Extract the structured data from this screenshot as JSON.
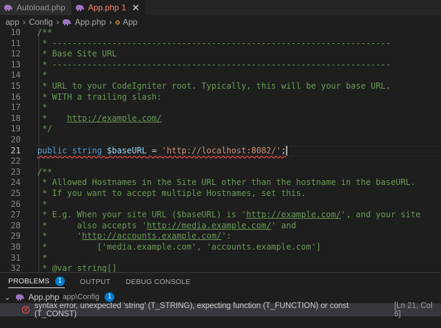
{
  "tabs": [
    {
      "label": "Autoload.php",
      "count": ""
    },
    {
      "label": "App.php",
      "count": "1",
      "close": "✕"
    }
  ],
  "breadcrumb": [
    "app",
    "Config",
    "App.php",
    "App"
  ],
  "symbol_glyph": "⚙",
  "editor": {
    "lines": [
      {
        "n": "10",
        "segs": [
          [
            "c-comment",
            "/**"
          ]
        ]
      },
      {
        "n": "11",
        "segs": [
          [
            "c-comment",
            " * --------------------------------------------------------------------"
          ]
        ]
      },
      {
        "n": "12",
        "segs": [
          [
            "c-comment",
            " * Base Site URL"
          ]
        ]
      },
      {
        "n": "13",
        "segs": [
          [
            "c-comment",
            " * --------------------------------------------------------------------"
          ]
        ]
      },
      {
        "n": "14",
        "segs": [
          [
            "c-comment",
            " *"
          ]
        ]
      },
      {
        "n": "15",
        "segs": [
          [
            "c-comment",
            " * URL to your CodeIgniter root. Typically, this will be your base URL,"
          ]
        ]
      },
      {
        "n": "16",
        "segs": [
          [
            "c-comment",
            " * WITH a trailing slash:"
          ]
        ]
      },
      {
        "n": "17",
        "segs": [
          [
            "c-comment",
            " *"
          ]
        ]
      },
      {
        "n": "18",
        "segs": [
          [
            "c-comment",
            " *    "
          ],
          [
            "c-link",
            "http://example.com/"
          ]
        ]
      },
      {
        "n": "19",
        "segs": [
          [
            "c-comment",
            " */"
          ]
        ]
      },
      {
        "n": "20",
        "segs": []
      },
      {
        "n": "21",
        "segs": [
          [
            "c-kw squiggle",
            "public string "
          ],
          [
            "c-var squiggle",
            "$baseURL"
          ],
          [
            "c-op squiggle",
            " = "
          ],
          [
            "c-str squiggle",
            "'http://localhost:8082/'"
          ],
          [
            "c-op squiggle",
            ";"
          ]
        ],
        "active": true
      },
      {
        "n": "22",
        "segs": []
      },
      {
        "n": "23",
        "segs": [
          [
            "c-comment",
            "/**"
          ]
        ]
      },
      {
        "n": "24",
        "segs": [
          [
            "c-comment",
            " * Allowed Hostnames in the Site URL other than the hostname in the baseURL."
          ]
        ]
      },
      {
        "n": "25",
        "segs": [
          [
            "c-comment",
            " * If you want to accept multiple Hostnames, set this."
          ]
        ]
      },
      {
        "n": "26",
        "segs": [
          [
            "c-comment",
            " *"
          ]
        ]
      },
      {
        "n": "27",
        "segs": [
          [
            "c-comment",
            " * E.g. When your site URL ($baseURL) is '"
          ],
          [
            "c-link",
            "http://example.com/"
          ],
          [
            "c-comment",
            "', and your site"
          ]
        ]
      },
      {
        "n": "28",
        "segs": [
          [
            "c-comment",
            " *      also accepts '"
          ],
          [
            "c-link",
            "http://media.example.com/"
          ],
          [
            "c-comment",
            "' and"
          ]
        ]
      },
      {
        "n": "29",
        "segs": [
          [
            "c-comment",
            " *      '"
          ],
          [
            "c-link",
            "http://accounts.example.com/"
          ],
          [
            "c-comment",
            "':"
          ]
        ]
      },
      {
        "n": "30",
        "segs": [
          [
            "c-comment",
            " *          ['media.example.com', 'accounts.example.com']"
          ]
        ]
      },
      {
        "n": "31",
        "segs": [
          [
            "c-comment",
            " *"
          ]
        ]
      },
      {
        "n": "32",
        "segs": [
          [
            "c-comment",
            " * @var string[]"
          ]
        ]
      }
    ]
  },
  "panel": {
    "tabs": [
      {
        "label": "PROBLEMS",
        "badge": "1"
      },
      {
        "label": "OUTPUT",
        "badge": ""
      },
      {
        "label": "DEBUG CONSOLE",
        "badge": ""
      }
    ],
    "file": {
      "chevron": "⌄",
      "name": "App.php",
      "path": "app\\Config",
      "badge": "1"
    },
    "error": {
      "icon": "✕",
      "message": "syntax error, unexpected 'string' (T_STRING), expecting function (T_FUNCTION) or const (T_CONST)",
      "location": "[Ln 21, Col 6]"
    }
  },
  "colors": {
    "accent": "#007acc",
    "error": "#f14c4c",
    "modified_tab": "#f48771"
  }
}
